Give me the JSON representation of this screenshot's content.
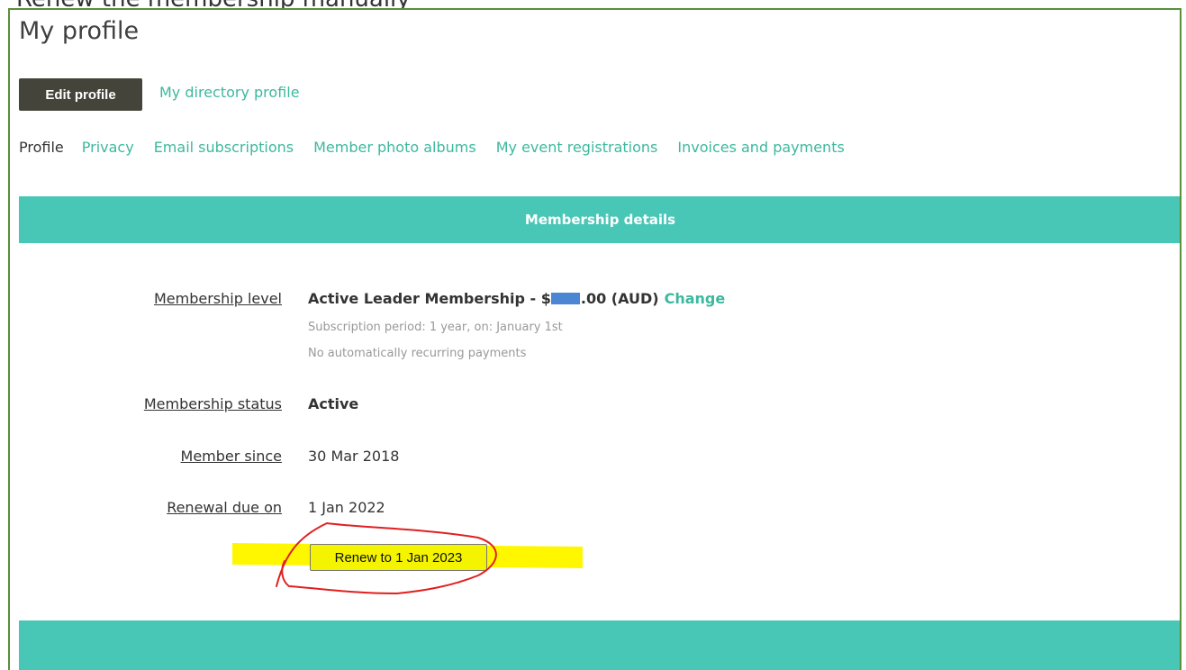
{
  "page": {
    "title": "My profile",
    "top_partial_text": "Renew the membership manually"
  },
  "actions": {
    "edit_profile_label": "Edit profile",
    "directory_link": "My directory profile"
  },
  "tabs": [
    {
      "label": "Profile",
      "current": true
    },
    {
      "label": "Privacy"
    },
    {
      "label": "Email subscriptions"
    },
    {
      "label": "Member photo albums"
    },
    {
      "label": "My event registrations"
    },
    {
      "label": "Invoices and payments"
    }
  ],
  "membership": {
    "header": "Membership details",
    "level_label": "Membership level",
    "level_prefix": "Active Leader Membership - $",
    "level_suffix": ".00 (AUD)",
    "change_label": "Change",
    "subscription_period": "Subscription period: 1 year, on: January 1st",
    "recurring": "No automatically recurring payments",
    "status_label": "Membership status",
    "status_value": "Active",
    "since_label": "Member since",
    "since_value": "30 Mar 2018",
    "renewal_label": "Renewal due on",
    "renewal_value": "1 Jan 2022",
    "renew_button": "Renew to 1 Jan 2023"
  },
  "colors": {
    "accent": "#48c6b6",
    "link": "#3db89f",
    "frame_border": "#5a8f3c",
    "button_dark": "#45443b",
    "highlight": "#fff700",
    "annotation_red": "#e02020",
    "redaction": "#4a86d4"
  }
}
